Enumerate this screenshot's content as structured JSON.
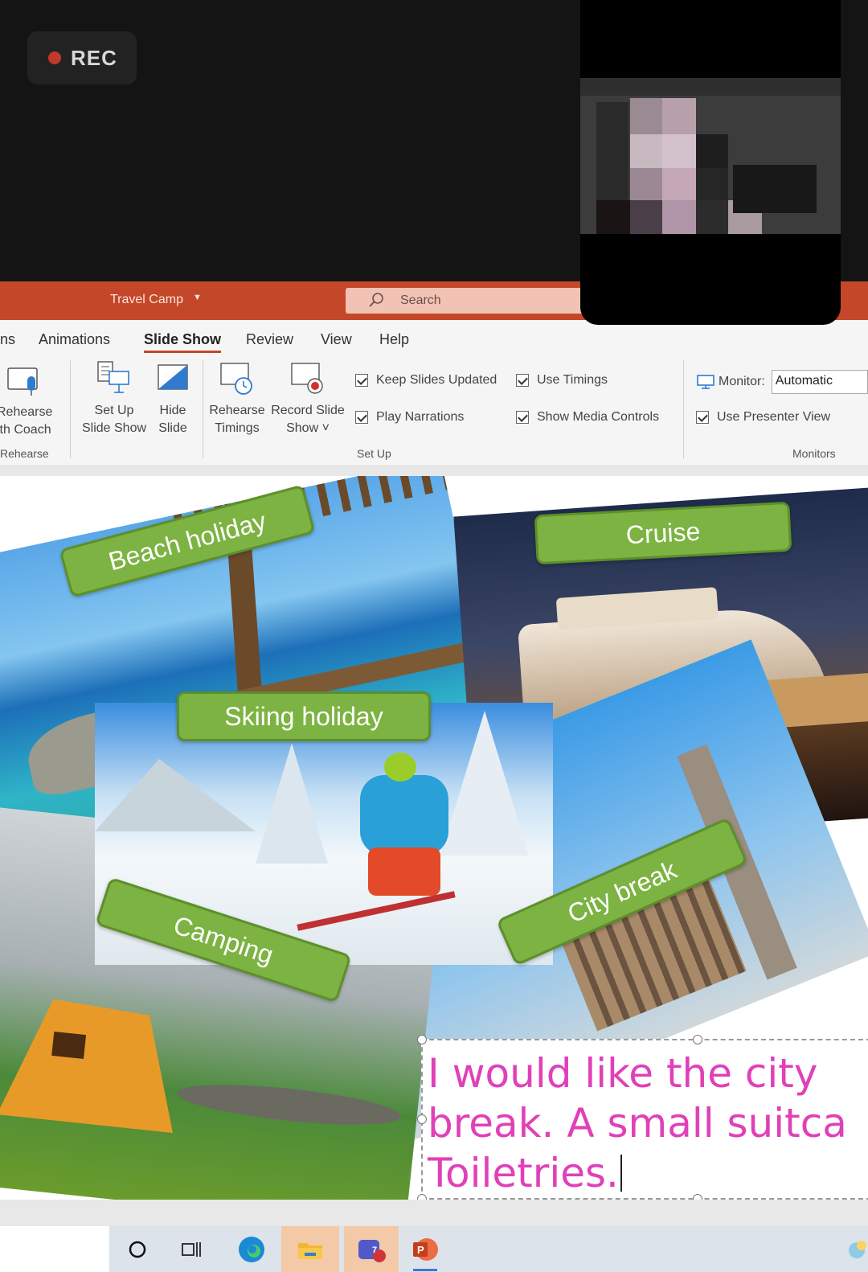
{
  "recording": {
    "label": "REC",
    "dot_color": "#c0392b"
  },
  "titlebar": {
    "doc_title": "Travel Camp",
    "search_placeholder": "Search",
    "accent_color": "#c4472a"
  },
  "tabs": [
    {
      "label": "ns"
    },
    {
      "label": "Animations"
    },
    {
      "label": "Slide Show",
      "active": true
    },
    {
      "label": "Review"
    },
    {
      "label": "View"
    },
    {
      "label": "Help"
    }
  ],
  "ribbon": {
    "rehearse_coach": {
      "line1": "Rehearse",
      "line2": "ith Coach"
    },
    "setup_slideshow": {
      "line1": "Set Up",
      "line2": "Slide Show"
    },
    "hide_slide": {
      "line1": "Hide",
      "line2": "Slide"
    },
    "rehearse_timings": {
      "line1": "Rehearse",
      "line2": "Timings"
    },
    "record_slideshow": {
      "line1": "Record Slide",
      "line2": "Show ˅"
    },
    "checkboxes": {
      "keep_updated": "Keep Slides Updated",
      "play_narrations": "Play Narrations",
      "use_timings": "Use Timings",
      "show_media_controls": "Show Media Controls",
      "use_presenter_view": "Use Presenter View"
    },
    "monitor": {
      "label": "Monitor:",
      "value": "Automatic"
    },
    "groups": {
      "rehearse": "Rehearse",
      "setup": "Set Up",
      "monitors": "Monitors"
    }
  },
  "slide": {
    "labels": {
      "beach": "Beach holiday",
      "cruise": "Cruise",
      "skiing": "Skiing holiday",
      "camping": "Camping",
      "city": "City break"
    },
    "label_color": "#7cb342",
    "text_box": "I would like the city\nbreak. A small suitca\nToiletries.",
    "text_color": "#e040b8"
  },
  "taskbar": {
    "icons": [
      "search-circle",
      "task-view",
      "edge",
      "file-explorer",
      "teams",
      "powerpoint"
    ],
    "teams_badge": "7"
  }
}
